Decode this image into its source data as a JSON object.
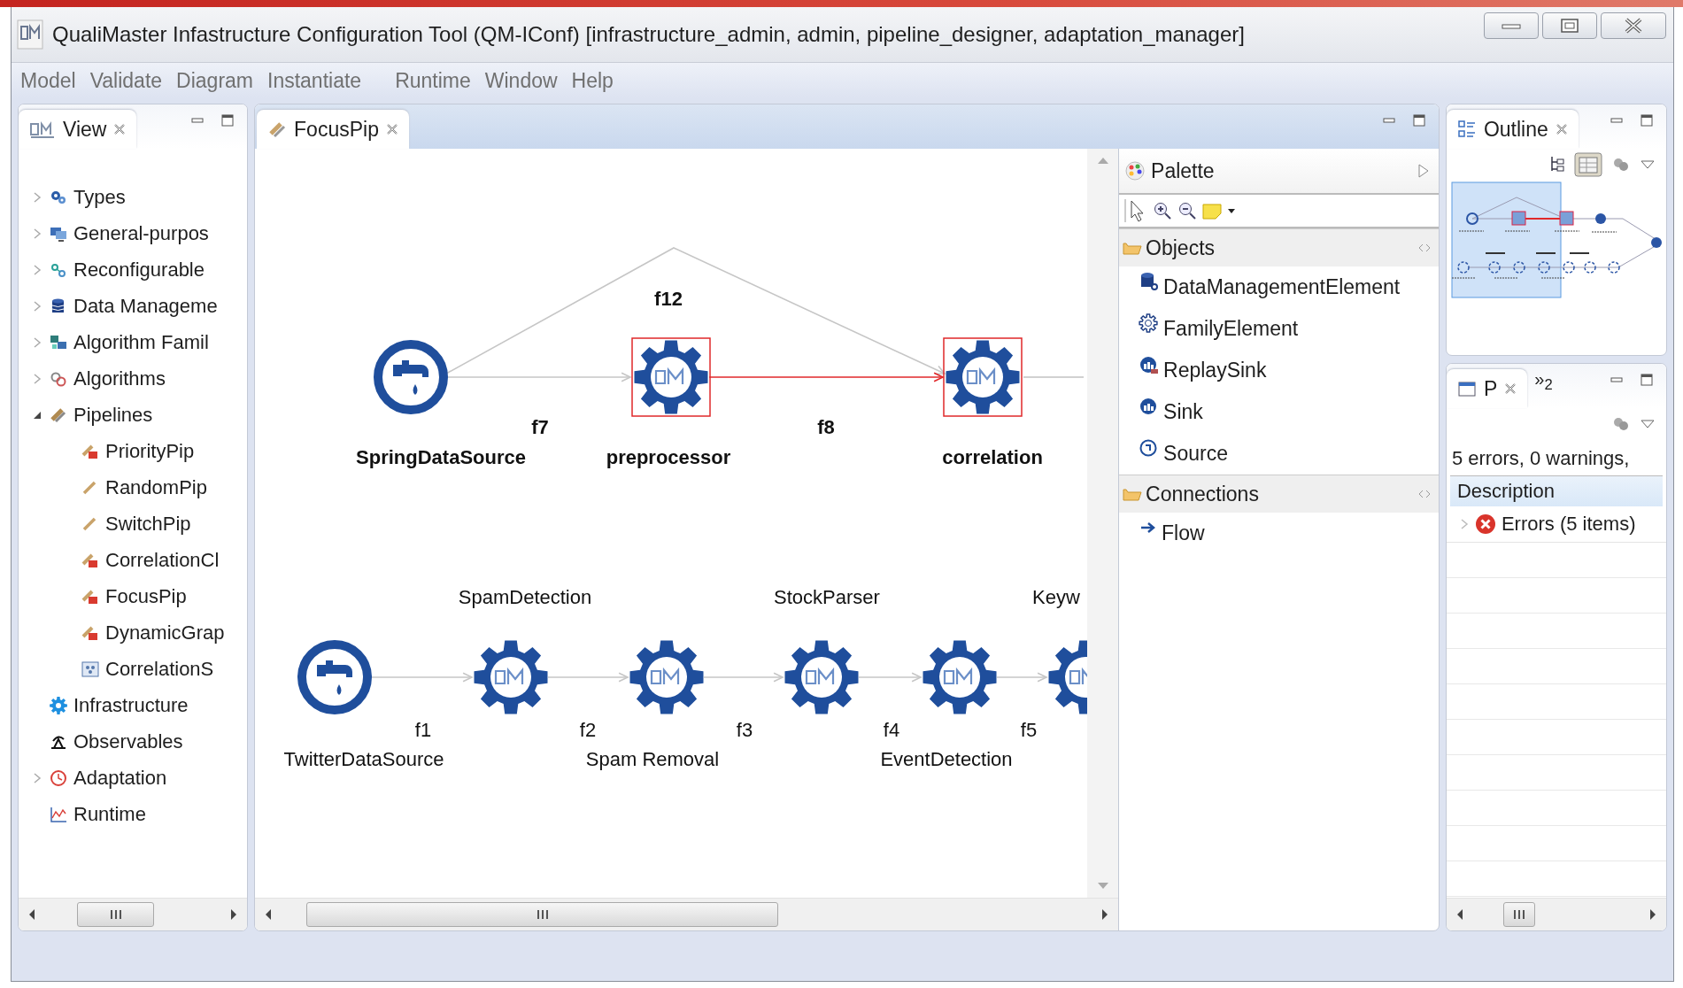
{
  "window": {
    "title": "QualiMaster Infastructure Configuration Tool (QM-IConf) [infrastructure_admin, admin, pipeline_designer, adaptation_manager]"
  },
  "menu": [
    "Model",
    "Validate",
    "Diagram",
    "Instantiate",
    "Runtime",
    "Window",
    "Help"
  ],
  "view_panel": {
    "tab": "View",
    "tree": [
      {
        "label": "Types",
        "expanded": false
      },
      {
        "label": "General-purpos",
        "expanded": false
      },
      {
        "label": "Reconfigurable",
        "expanded": false
      },
      {
        "label": "Data Manageme",
        "expanded": false
      },
      {
        "label": "Algorithm Famil",
        "expanded": false
      },
      {
        "label": "Algorithms",
        "expanded": false
      },
      {
        "label": "Pipelines",
        "expanded": true,
        "children": [
          {
            "label": "PriorityPip",
            "kind": "pipeline",
            "error": true
          },
          {
            "label": "RandomPip",
            "kind": "pipeline",
            "error": false
          },
          {
            "label": "SwitchPip",
            "kind": "pipeline",
            "error": false
          },
          {
            "label": "CorrelationCl",
            "kind": "pipeline",
            "error": true
          },
          {
            "label": "FocusPip",
            "kind": "pipeline",
            "error": true
          },
          {
            "label": "DynamicGrap",
            "kind": "pipeline",
            "error": true
          },
          {
            "label": "CorrelationS",
            "kind": "subpipeline",
            "error": false
          }
        ]
      },
      {
        "label": "Infrastructure"
      },
      {
        "label": "Observables"
      },
      {
        "label": "Adaptation",
        "expanded": false
      },
      {
        "label": "Runtime"
      }
    ]
  },
  "editor": {
    "tab": "FocusPip",
    "nodes": [
      {
        "kind": "source",
        "label": "SpringDataSource",
        "selected": false
      },
      {
        "kind": "processor",
        "label": "preprocessor",
        "selected": true
      },
      {
        "kind": "processor",
        "label": "correlation",
        "selected": true
      },
      {
        "kind": "source",
        "label": "TwitterDataSource",
        "selected": false
      },
      {
        "kind": "processor",
        "label": "SpamDetection",
        "selected": false
      },
      {
        "kind": "processor",
        "label": "Spam Removal",
        "selected": false
      },
      {
        "kind": "processor",
        "label": "StockParser",
        "selected": false
      },
      {
        "kind": "processor",
        "label": "EventDetection",
        "selected": false
      },
      {
        "kind": "processor",
        "label": "Keyw",
        "selected": false
      }
    ],
    "flows": [
      {
        "label": "f12",
        "selected": false
      },
      {
        "label": "f7",
        "selected": false
      },
      {
        "label": "f8",
        "selected": true
      },
      {
        "selected": false
      },
      {
        "label": "f1",
        "selected": false
      },
      {
        "label": "f2",
        "selected": false
      },
      {
        "label": "f3",
        "selected": false
      },
      {
        "label": "f4",
        "selected": false
      },
      {
        "label": "f5",
        "selected": false
      }
    ],
    "palette": {
      "title": "Palette",
      "drawers": [
        {
          "label": "Objects",
          "items": [
            "DataManagementElement",
            "FamilyElement",
            "ReplaySink",
            "Sink",
            "Source"
          ]
        },
        {
          "label": "Connections",
          "items": [
            "Flow"
          ]
        }
      ]
    }
  },
  "outline_panel": {
    "tab": "Outline"
  },
  "problems_panel": {
    "tab": "P",
    "overflow": "»$_{2}$",
    "summary": "5 errors, 0 warnings,",
    "columns": [
      "Description"
    ],
    "rows": [
      {
        "label": "Errors (5 items)",
        "expanded": false
      }
    ]
  }
}
